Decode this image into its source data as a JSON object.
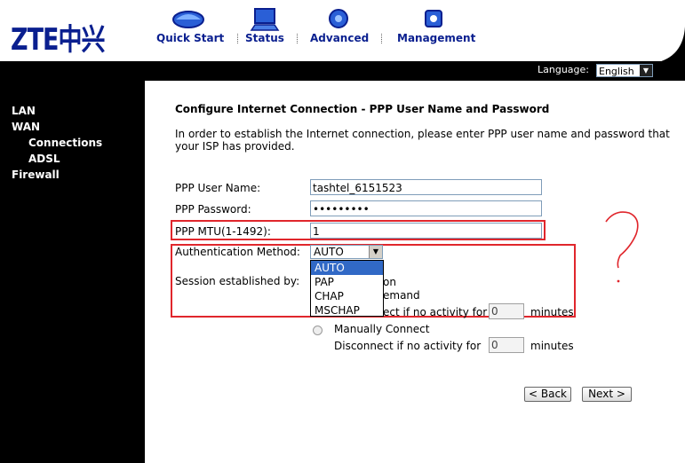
{
  "brand": {
    "logo_text": "ZTE中兴"
  },
  "nav": {
    "items": [
      {
        "label": "Quick Start",
        "icon": "quick-start-icon"
      },
      {
        "label": "Status",
        "icon": "status-monitor-icon"
      },
      {
        "label": "Advanced",
        "icon": "advanced-chip-icon"
      },
      {
        "label": "Management",
        "icon": "management-icon"
      }
    ]
  },
  "language": {
    "label": "Language:",
    "selected": "English"
  },
  "sidebar": {
    "items": [
      {
        "label": "LAN"
      },
      {
        "label": "WAN"
      },
      {
        "label": "Connections"
      },
      {
        "label": "ADSL"
      },
      {
        "label": "Firewall"
      }
    ]
  },
  "form": {
    "title": "Configure Internet Connection - PPP User Name and Password",
    "description": "In order to establish the Internet connection, please enter PPP user name and password that your ISP has provided.",
    "username_label": "PPP User Name:",
    "username_value": "tashtel_6151523",
    "password_label": "PPP Password:",
    "password_value": "•••••••••",
    "mtu_label": "PPP MTU(1-1492):",
    "mtu_value": "1",
    "auth_label": "Authentication Method:",
    "auth_selected": "AUTO",
    "auth_options": [
      "AUTO",
      "PAP",
      "CHAP",
      "MSCHAP"
    ],
    "session_label": "Session established by:",
    "session_partial_1": "on",
    "session_partial_2": "emand",
    "session_partial_3": "ect if no activity for",
    "session_value_1": "0",
    "session_unit_1": "minutes",
    "manual_label": "Manually Connect",
    "manual_disconnect_label": "Disconnect if no activity for",
    "manual_value": "0",
    "manual_unit": "minutes"
  },
  "buttons": {
    "back": "< Back",
    "next": "Next >"
  },
  "annotation": {
    "mark": "?",
    "color": "#e0262c"
  },
  "colors": {
    "brand_blue": "#0a1f8f",
    "highlight_red": "#e0262c",
    "selection_blue": "#3169c6"
  }
}
